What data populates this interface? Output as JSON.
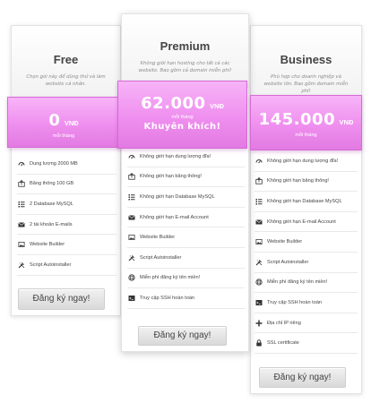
{
  "plans": [
    {
      "name": "Free",
      "description": "Chọn gói này để dùng thử và làm website cá nhân.",
      "price": "0",
      "currency": "VNĐ",
      "period": "mỗi tháng",
      "promo": "",
      "features": [
        {
          "icon": "dashboard-icon",
          "label": "Dung lượng 2000 MB"
        },
        {
          "icon": "upload-icon",
          "label": "Băng thông 100 GB"
        },
        {
          "icon": "list-icon",
          "label": "2 Database MySQL"
        },
        {
          "icon": "mail-icon",
          "label": "2 tài khoản E-mails"
        },
        {
          "icon": "image-icon",
          "label": "Website Builder"
        },
        {
          "icon": "tools-icon",
          "label": "Script Autoinstaller"
        }
      ],
      "button": "Đăng ký ngay!"
    },
    {
      "name": "Premium",
      "description": "Không giới hạn hosting cho tất cả các website. Bao gồm cả domain miễn phí!",
      "price": "62.000",
      "currency": "VNĐ",
      "period": "mỗi tháng",
      "promo": "Khuyên khích!",
      "features": [
        {
          "icon": "dashboard-icon",
          "label": "Không giới hạn dung lượng đĩa!"
        },
        {
          "icon": "upload-icon",
          "label": "Không giới hạn băng thông!"
        },
        {
          "icon": "list-icon",
          "label": "Không giới hạn Database MySQL"
        },
        {
          "icon": "mail-icon",
          "label": "Không giới hạn E-mail Account"
        },
        {
          "icon": "image-icon",
          "label": "Website Builder"
        },
        {
          "icon": "tools-icon",
          "label": "Script Autoinstaller"
        },
        {
          "icon": "globe-icon",
          "label": "Miễn phí đăng ký tên miền!"
        },
        {
          "icon": "terminal-icon",
          "label": "Truy cập SSH hoàn toàn"
        }
      ],
      "button": "Đăng ký ngay!"
    },
    {
      "name": "Business",
      "description": "Phù hợp cho doanh nghiệp và website lớn. Bao gồm domain miễn phí!",
      "price": "145.000",
      "currency": "VNĐ",
      "period": "mỗi tháng",
      "promo": "",
      "features": [
        {
          "icon": "dashboard-icon",
          "label": "Không giới hạn dung lượng đĩa!"
        },
        {
          "icon": "upload-icon",
          "label": "Không giới hạn băng thông!"
        },
        {
          "icon": "list-icon",
          "label": "Không giới hạn Database MySQL"
        },
        {
          "icon": "mail-icon",
          "label": "Không giới hạn E-mail Account"
        },
        {
          "icon": "image-icon",
          "label": "Website Builder"
        },
        {
          "icon": "tools-icon",
          "label": "Script Autoinstaller"
        },
        {
          "icon": "globe-icon",
          "label": "Miễn phí đăng ký tên miền!"
        },
        {
          "icon": "terminal-icon",
          "label": "Truy cập SSH hoàn toàn"
        },
        {
          "icon": "plus-icon",
          "label": "Địa chỉ IP riêng"
        },
        {
          "icon": "lock-icon",
          "label": "SSL certificate"
        }
      ],
      "button": "Đăng ký ngay!"
    }
  ]
}
